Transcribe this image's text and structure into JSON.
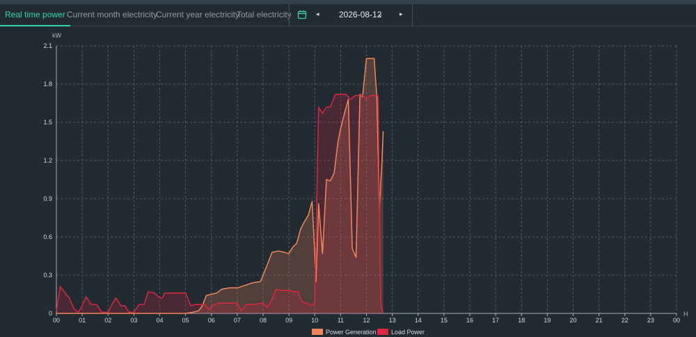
{
  "tabs": [
    {
      "label": "Real time power",
      "active": true
    },
    {
      "label": "Current month electricity",
      "active": false
    },
    {
      "label": "Current year electricity",
      "active": false
    },
    {
      "label": "Total electricity",
      "active": false
    }
  ],
  "date_picker": {
    "icon": "calendar-icon",
    "prev": "◂",
    "next": "▸",
    "value": "2026-08-12",
    "dropdown": "⌄"
  },
  "colors": {
    "accent": "#33d6a6",
    "generation": "#f4885a",
    "load": "#e0253f",
    "grid": "#5f6a74",
    "background": "#232b32"
  },
  "chart_data": {
    "type": "area",
    "ylabel": "kW",
    "xlabel": "H",
    "ylim": [
      0,
      2.1
    ],
    "yticks": [
      "0",
      "0.3",
      "0.6",
      "0.9",
      "1.2",
      "1.5",
      "1.8",
      "2.1"
    ],
    "xlim": [
      0,
      24
    ],
    "xticks": [
      "00",
      "01",
      "02",
      "03",
      "04",
      "05",
      "06",
      "07",
      "08",
      "09",
      "10",
      "11",
      "12",
      "13",
      "14",
      "15",
      "16",
      "17",
      "18",
      "19",
      "20",
      "21",
      "22",
      "23",
      "00"
    ],
    "grid": true,
    "legend_position": "bottom-center",
    "series": [
      {
        "name": "Power Generation",
        "color": "#f4885a",
        "x": [
          0,
          0.2,
          0.5,
          1,
          1.5,
          2,
          2.5,
          3,
          3.5,
          4,
          4.5,
          5,
          5.3,
          5.5,
          5.65,
          5.8,
          6,
          6.2,
          6.4,
          6.7,
          7,
          7.3,
          7.6,
          7.9,
          8.1,
          8.35,
          8.6,
          8.8,
          9,
          9.15,
          9.3,
          9.45,
          9.6,
          9.75,
          9.9,
          10.05,
          10.15,
          10.3,
          10.45,
          10.6,
          10.75,
          10.9,
          11,
          11.15,
          11.3,
          11.45,
          11.6,
          11.75,
          11.85,
          12,
          12.1,
          12.2,
          12.3,
          12.4,
          12.5,
          12.6,
          12.65
        ],
        "values": [
          0,
          0,
          0,
          0,
          0,
          0,
          0,
          0,
          0,
          0,
          0,
          0,
          0.01,
          0.02,
          0.06,
          0.14,
          0.15,
          0.16,
          0.19,
          0.2,
          0.2,
          0.22,
          0.24,
          0.25,
          0.35,
          0.48,
          0.49,
          0.48,
          0.47,
          0.52,
          0.55,
          0.66,
          0.72,
          0.77,
          0.88,
          0.25,
          0.86,
          0.47,
          1.05,
          1.04,
          1.1,
          1.35,
          1.45,
          1.57,
          1.68,
          0.51,
          0.44,
          1.72,
          1.7,
          2.0,
          2.0,
          2.0,
          2.0,
          1.7,
          0.82,
          1.2,
          1.43
        ]
      },
      {
        "name": "Load Power",
        "color": "#e0253f",
        "x": [
          0,
          0.15,
          0.3,
          0.5,
          0.7,
          0.85,
          1,
          1.15,
          1.35,
          1.55,
          1.75,
          2,
          2.15,
          2.3,
          2.5,
          2.65,
          2.8,
          3,
          3.2,
          3.4,
          3.55,
          3.8,
          4,
          4.1,
          4.2,
          4.35,
          4.6,
          5,
          5.2,
          5.35,
          5.55,
          5.75,
          5.9,
          6.1,
          6.3,
          6.6,
          7,
          7.15,
          7.35,
          7.6,
          8,
          8.15,
          8.3,
          8.5,
          8.7,
          9,
          9.2,
          9.35,
          9.5,
          9.7,
          9.85,
          10.0,
          10.15,
          10.3,
          10.45,
          10.6,
          10.8,
          11,
          11.2,
          11.4,
          11.55,
          11.7,
          11.85,
          12,
          12.15,
          12.3,
          12.45,
          12.55,
          12.65
        ],
        "values": [
          0.02,
          0.21,
          0.17,
          0.12,
          0.03,
          0.01,
          0.06,
          0.13,
          0.07,
          0.07,
          0.01,
          0.01,
          0.07,
          0.12,
          0.06,
          0.06,
          0.01,
          0.01,
          0.07,
          0.07,
          0.17,
          0.16,
          0.12,
          0.12,
          0.16,
          0.16,
          0.16,
          0.16,
          0.06,
          0.07,
          0.07,
          0.07,
          0.03,
          0.07,
          0.08,
          0.08,
          0.08,
          0.02,
          0.07,
          0.07,
          0.08,
          0.05,
          0.09,
          0.19,
          0.18,
          0.18,
          0.17,
          0.17,
          0.09,
          0.08,
          0.06,
          0.08,
          1.62,
          1.57,
          1.62,
          1.62,
          1.72,
          1.72,
          1.72,
          1.68,
          1.71,
          1.71,
          1.71,
          1.68,
          1.71,
          1.71,
          1.71,
          0.08,
          0.0
        ]
      }
    ]
  }
}
